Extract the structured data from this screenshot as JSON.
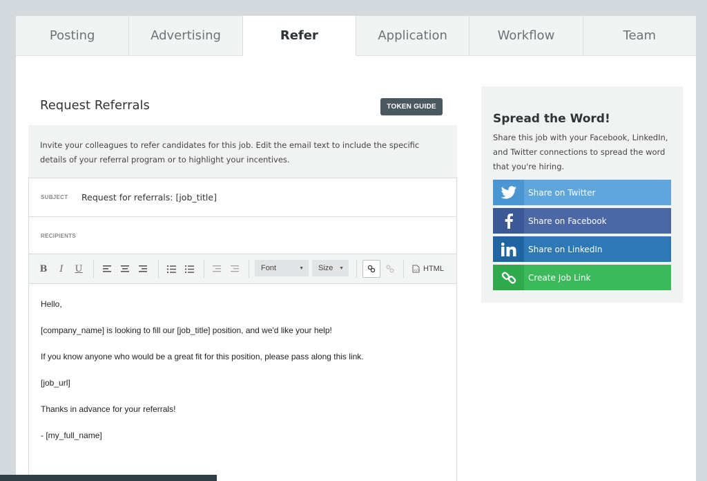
{
  "tabs": [
    "Posting",
    "Advertising",
    "Refer",
    "Application",
    "Workflow",
    "Team"
  ],
  "active_tab": "Refer",
  "main": {
    "title": "Request Referrals",
    "token_button": "TOKEN GUIDE",
    "intro": "Invite your colleagues to refer candidates for this job. Edit the email text to include the specific details of your referral program or to highlight your incentives.",
    "subject_label": "SUBJECT",
    "subject_value": "Request for referrals: [job_title]",
    "recipients_label": "RECIPIENTS",
    "toolbar": {
      "bold": "B",
      "italic": "I",
      "underline": "U",
      "font_select": "Font",
      "size_select": "Size",
      "html_button": "HTML"
    },
    "body_lines": [
      "Hello,",
      "[company_name] is looking to fill our [job_title] position, and we'd like your help!",
      "If you know anyone who would be a great fit for this position, please pass along this link.",
      "[job_url]",
      "Thanks in advance for your referrals!",
      "- [my_full_name]"
    ]
  },
  "sidebar": {
    "title": "Spread the Word!",
    "text": "Share this job with your Facebook, LinkedIn, and Twitter connections to spread the word that you're hiring.",
    "buttons": [
      {
        "label": "Share on Twitter",
        "color": "#5ea6dc"
      },
      {
        "label": "Share on Facebook",
        "color": "#4b68a5"
      },
      {
        "label": "Share on LinkedIn",
        "color": "#2e78b6"
      },
      {
        "label": "Create Job Link",
        "color": "#3cb95a"
      }
    ]
  }
}
